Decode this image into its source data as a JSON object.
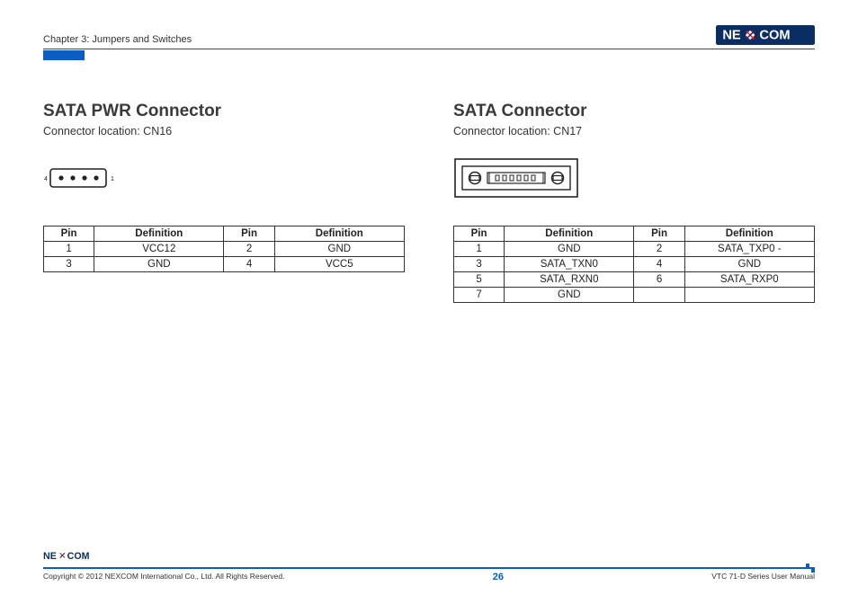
{
  "header": {
    "chapter": "Chapter 3: Jumpers and Switches",
    "brand": "NEXCOM"
  },
  "left": {
    "title": "SATA PWR Connector",
    "subtitle": "Connector location: CN16",
    "pin_label_4": "4",
    "pin_label_1": "1",
    "table": {
      "headers": [
        "Pin",
        "Definition",
        "Pin",
        "Definition"
      ],
      "rows": [
        [
          "1",
          "VCC12",
          "2",
          "GND"
        ],
        [
          "3",
          "GND",
          "4",
          "VCC5"
        ]
      ]
    }
  },
  "right": {
    "title": "SATA Connector",
    "subtitle": "Connector location: CN17",
    "table": {
      "headers": [
        "Pin",
        "Definition",
        "Pin",
        "Definition"
      ],
      "rows": [
        [
          "1",
          "GND",
          "2",
          "SATA_TXP0 -"
        ],
        [
          "3",
          "SATA_TXN0",
          "4",
          "GND"
        ],
        [
          "5",
          "SATA_RXN0",
          "6",
          "SATA_RXP0"
        ],
        [
          "7",
          "GND",
          "",
          ""
        ]
      ]
    }
  },
  "footer": {
    "copyright": "Copyright © 2012 NEXCOM International Co., Ltd. All Rights Reserved.",
    "page": "26",
    "doc": "VTC 71-D Series User Manual"
  }
}
